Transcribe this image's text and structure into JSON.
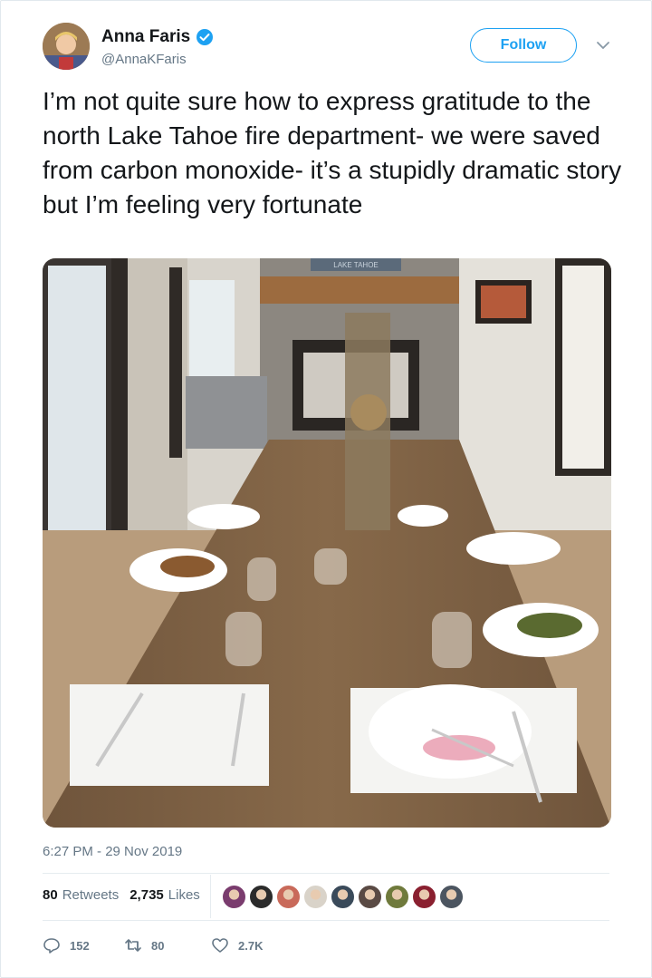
{
  "user": {
    "display_name": "Anna Faris",
    "handle": "@AnnaKFaris",
    "verified": true,
    "avatar_icon": "avatar-child-photo"
  },
  "follow_label": "Follow",
  "tweet": {
    "text": "I’m not quite sure how to express gratitude to the north Lake Tahoe fire department- we were saved from carbon monoxide- it’s a stupidly dramatic story but I’m feeling very fortunate"
  },
  "photo": {
    "sign_text": "LAKE TAHOE"
  },
  "timestamp": "6:27 PM - 29 Nov 2019",
  "stats": {
    "retweets_count": "80",
    "retweets_label": "Retweets",
    "likes_count": "2,735",
    "likes_label": "Likes"
  },
  "likers": [
    "#7a3c6e",
    "#2b2b2b",
    "#c96a5a",
    "#d9d3c9",
    "#3a4a5a",
    "#5a4a44",
    "#6f7a3c",
    "#8a2030",
    "#4c5560"
  ],
  "actions": {
    "reply_count": "152",
    "retweet_count": "80",
    "like_count": "2.7K"
  },
  "colors": {
    "accent": "#1da1f2",
    "secondary_text": "#657786",
    "primary_text": "#14171a"
  }
}
